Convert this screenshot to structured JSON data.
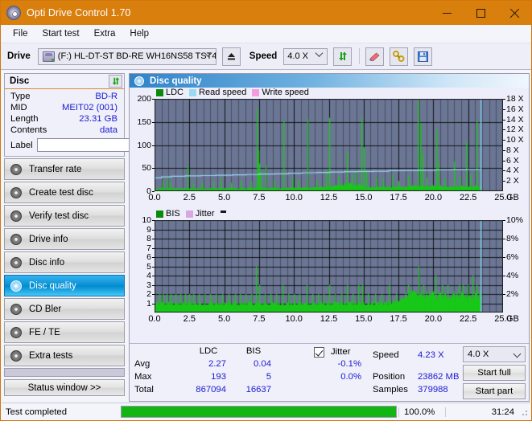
{
  "window": {
    "title": "Opti Drive Control 1.70",
    "app_icon": "disc-icon",
    "minimize": "—",
    "maximize": "□",
    "close": "✕"
  },
  "menu": [
    {
      "label": "File"
    },
    {
      "label": "Start test"
    },
    {
      "label": "Extra"
    },
    {
      "label": "Help"
    }
  ],
  "toolbar": {
    "drive_label": "Drive",
    "drive_value": "(F:)  HL-DT-ST BD-RE  WH16NS58 TST4",
    "eject_icon": "eject-icon",
    "speed_label": "Speed",
    "speed_value": "4.0 X",
    "refresh_icon": "refresh-icon",
    "erase_icon": "eraser-icon",
    "tools_icon": "tools-icon",
    "save_icon": "save-icon"
  },
  "disc_panel": {
    "title": "Disc",
    "refresh_icon": "refresh-icon",
    "rows": [
      {
        "key": "Type",
        "value": "BD-R"
      },
      {
        "key": "MID",
        "value": "MEIT02 (001)"
      },
      {
        "key": "Length",
        "value": "23.31 GB"
      },
      {
        "key": "Contents",
        "value": "data"
      }
    ],
    "label_key": "Label",
    "label_value": "",
    "label_placeholder": "",
    "disc_button_icon": "cd-icon"
  },
  "nav": {
    "items": [
      {
        "label": "Transfer rate",
        "icon": "disc-icon",
        "selected": false
      },
      {
        "label": "Create test disc",
        "icon": "disc-icon",
        "selected": false
      },
      {
        "label": "Verify test disc",
        "icon": "disc-icon",
        "selected": false
      },
      {
        "label": "Drive info",
        "icon": "disc-icon",
        "selected": false
      },
      {
        "label": "Disc info",
        "icon": "disc-icon",
        "selected": false
      },
      {
        "label": "Disc quality",
        "icon": "disc-icon",
        "selected": true
      },
      {
        "label": "CD Bler",
        "icon": "disc-icon",
        "selected": false
      },
      {
        "label": "FE / TE",
        "icon": "disc-icon",
        "selected": false
      },
      {
        "label": "Extra tests",
        "icon": "disc-icon",
        "selected": false
      }
    ],
    "status_window": "Status window >>"
  },
  "panel": {
    "header_title": "Disc quality",
    "header_icon": "disc-quality-icon"
  },
  "stats": {
    "col_ldc": "LDC",
    "col_bis": "BIS",
    "row_avg": "Avg",
    "row_max": "Max",
    "row_total": "Total",
    "ldc_avg": "2.27",
    "ldc_max": "193",
    "ldc_total": "867094",
    "bis_avg": "0.04",
    "bis_max": "5",
    "bis_total": "16637",
    "jitter_label": "Jitter",
    "jitter_checked": true,
    "jitter_avg": "-0.1%",
    "jitter_max": "0.0%",
    "speed_label": "Speed",
    "speed_value": "4.23 X",
    "position_label": "Position",
    "position_value": "23862 MB",
    "samples_label": "Samples",
    "samples_value": "379988",
    "speed_select": "4.0 X",
    "start_full": "Start full",
    "start_part": "Start part"
  },
  "statusbar": {
    "text": "Test completed",
    "percent": "100.0%",
    "progress": 100,
    "elapsed": "31:24"
  },
  "colors": {
    "titlebar": "#d97f0d",
    "accent_green": "#18c818",
    "read_speed": "#9ad9f5",
    "write_speed": "#f59ce0",
    "plot_bg": "#6b7694",
    "value_blue": "#1a1ad0",
    "selection": "#0a8fd4"
  },
  "chart_data": [
    {
      "type": "area",
      "name": "ldc-chart",
      "title": "",
      "xlabel": "GB",
      "ylabel": "LDC",
      "xlim": [
        0,
        25
      ],
      "ylim": [
        0,
        200
      ],
      "y2lim": [
        0,
        18
      ],
      "y2label": "X",
      "grid": true,
      "legend_position": "top-left",
      "legend": [
        {
          "name": "LDC",
          "color": "#0a8a0a"
        },
        {
          "name": "Read speed",
          "color": "#9ad9f5"
        },
        {
          "name": "Write speed",
          "color": "#f59ce0"
        }
      ],
      "yticks": [
        0,
        50,
        100,
        150,
        200
      ],
      "ytick_labels": [
        "0",
        "50",
        "100",
        "150",
        "200"
      ],
      "y2ticks": [
        2,
        4,
        6,
        8,
        10,
        12,
        14,
        16,
        18
      ],
      "y2tick_labels": [
        "2 X",
        "4 X",
        "6 X",
        "8 X",
        "10 X",
        "12 X",
        "14 X",
        "16 X",
        "18 X"
      ],
      "xticks": [
        0,
        2.5,
        5,
        7.5,
        10,
        12.5,
        15,
        17.5,
        20,
        22.5,
        25
      ],
      "xtick_labels": [
        "0.0",
        "2.5",
        "5.0",
        "7.5",
        "10.0",
        "12.5",
        "15.0",
        "17.5",
        "20.0",
        "22.5",
        "25.0"
      ],
      "data_end_gb": 23.4,
      "series": [
        {
          "name": "LDC",
          "color": "#18c818",
          "baseline_x": [
            0.0,
            1.0,
            2.0,
            3.0,
            4.0,
            5.0,
            6.0,
            7.0,
            8.0,
            9.0,
            10.0,
            11.0,
            12.0,
            13.0,
            13.8,
            14.5,
            15.2,
            16.0,
            17.0,
            18.0,
            19.0,
            20.0,
            21.0,
            22.0,
            23.0,
            23.4
          ],
          "baseline_y": [
            5,
            6,
            6,
            6,
            6,
            6,
            6,
            7,
            7,
            7,
            7,
            8,
            9,
            11,
            16,
            14,
            10,
            9,
            9,
            10,
            11,
            11,
            11,
            11,
            11,
            10
          ],
          "spikes": [
            {
              "x": 0.55,
              "y": 22
            },
            {
              "x": 0.9,
              "y": 33
            },
            {
              "x": 1.15,
              "y": 18
            },
            {
              "x": 2.35,
              "y": 55
            },
            {
              "x": 2.75,
              "y": 17
            },
            {
              "x": 3.4,
              "y": 19
            },
            {
              "x": 4.2,
              "y": 22
            },
            {
              "x": 4.75,
              "y": 29
            },
            {
              "x": 5.5,
              "y": 18
            },
            {
              "x": 6.2,
              "y": 24
            },
            {
              "x": 6.95,
              "y": 20
            },
            {
              "x": 7.32,
              "y": 179
            },
            {
              "x": 7.42,
              "y": 88
            },
            {
              "x": 7.5,
              "y": 60
            },
            {
              "x": 7.62,
              "y": 42
            },
            {
              "x": 7.95,
              "y": 57
            },
            {
              "x": 8.55,
              "y": 26
            },
            {
              "x": 9.25,
              "y": 153
            },
            {
              "x": 9.85,
              "y": 30
            },
            {
              "x": 10.3,
              "y": 24
            },
            {
              "x": 10.95,
              "y": 156
            },
            {
              "x": 11.6,
              "y": 25
            },
            {
              "x": 12.3,
              "y": 45
            },
            {
              "x": 12.55,
              "y": 159
            },
            {
              "x": 13.15,
              "y": 33
            },
            {
              "x": 13.8,
              "y": 86
            },
            {
              "x": 14.15,
              "y": 36
            },
            {
              "x": 14.45,
              "y": 46
            },
            {
              "x": 14.82,
              "y": 159
            },
            {
              "x": 15.0,
              "y": 95
            },
            {
              "x": 15.2,
              "y": 44
            },
            {
              "x": 15.9,
              "y": 31
            },
            {
              "x": 16.4,
              "y": 28
            },
            {
              "x": 17.05,
              "y": 38
            },
            {
              "x": 17.5,
              "y": 22
            },
            {
              "x": 18.2,
              "y": 34
            },
            {
              "x": 18.9,
              "y": 196
            },
            {
              "x": 19.05,
              "y": 148
            },
            {
              "x": 19.2,
              "y": 82
            },
            {
              "x": 19.5,
              "y": 29
            },
            {
              "x": 20.2,
              "y": 134
            },
            {
              "x": 20.35,
              "y": 62
            },
            {
              "x": 20.8,
              "y": 27
            },
            {
              "x": 21.5,
              "y": 64
            },
            {
              "x": 21.9,
              "y": 33
            },
            {
              "x": 22.35,
              "y": 107
            },
            {
              "x": 22.65,
              "y": 38
            },
            {
              "x": 23.1,
              "y": 153
            }
          ]
        },
        {
          "name": "Read speed",
          "color": "#9ad9f5",
          "axis": "right",
          "x": [
            0.0,
            0.5,
            1.2,
            2.2,
            3.3,
            4.4,
            5.6,
            6.6,
            7.5,
            8.6,
            9.6,
            10.6,
            11.6,
            12.6,
            13.6,
            14.6,
            15.7,
            16.8,
            17.9,
            19.0,
            20.2,
            21.3,
            22.4,
            23.4
          ],
          "y": [
            2.6,
            2.8,
            2.9,
            3.0,
            3.05,
            3.1,
            3.2,
            3.25,
            3.35,
            3.4,
            3.5,
            3.6,
            3.65,
            3.75,
            3.8,
            3.85,
            3.9,
            4.0,
            4.05,
            4.1,
            4.15,
            4.2,
            4.23,
            4.23
          ]
        },
        {
          "name": "vertical-marker",
          "color": "#7fd4f2",
          "type": "vline",
          "x": 23.4
        }
      ]
    },
    {
      "type": "area",
      "name": "bis-chart",
      "title": "",
      "xlabel": "GB",
      "ylabel": "BIS",
      "xlim": [
        0,
        25
      ],
      "ylim": [
        0,
        10
      ],
      "y2lim": [
        0,
        10
      ],
      "y2label": "%",
      "grid": true,
      "legend_position": "top-left",
      "legend": [
        {
          "name": "BIS",
          "color": "#0a8a0a"
        },
        {
          "name": "Jitter",
          "color": "#d9a8e0"
        }
      ],
      "yticks": [
        1,
        2,
        3,
        4,
        5,
        6,
        7,
        8,
        9,
        10
      ],
      "ytick_labels": [
        "1",
        "2",
        "3",
        "4",
        "5",
        "6",
        "7",
        "8",
        "9",
        "10"
      ],
      "y2ticks": [
        2,
        4,
        6,
        8,
        10
      ],
      "y2tick_labels": [
        "2%",
        "4%",
        "6%",
        "8%",
        "10%"
      ],
      "xticks": [
        0,
        2.5,
        5,
        7.5,
        10,
        12.5,
        15,
        17.5,
        20,
        22.5,
        25
      ],
      "xtick_labels": [
        "0.0",
        "2.5",
        "5.0",
        "7.5",
        "10.0",
        "12.5",
        "15.0",
        "17.5",
        "20.0",
        "22.5",
        "25.0"
      ],
      "data_end_gb": 23.4,
      "series": [
        {
          "name": "BIS",
          "color": "#18c818",
          "baseline_x": [
            0.0,
            5.0,
            10.0,
            14.0,
            16.0,
            17.6,
            17.9,
            20.0,
            22.0,
            23.4
          ],
          "baseline_y": [
            1.0,
            1.0,
            1.0,
            1.0,
            1.1,
            1.2,
            2.0,
            2.0,
            2.0,
            2.0
          ],
          "spikes": [
            {
              "x": 0.35,
              "y": 2
            },
            {
              "x": 0.6,
              "y": 2
            },
            {
              "x": 0.85,
              "y": 2
            },
            {
              "x": 1.15,
              "y": 2
            },
            {
              "x": 1.5,
              "y": 2
            },
            {
              "x": 1.85,
              "y": 2
            },
            {
              "x": 2.2,
              "y": 2
            },
            {
              "x": 2.5,
              "y": 2
            },
            {
              "x": 2.8,
              "y": 2
            },
            {
              "x": 3.2,
              "y": 2
            },
            {
              "x": 3.6,
              "y": 2
            },
            {
              "x": 4.0,
              "y": 2
            },
            {
              "x": 4.4,
              "y": 2
            },
            {
              "x": 4.85,
              "y": 2
            },
            {
              "x": 5.3,
              "y": 2
            },
            {
              "x": 5.75,
              "y": 2
            },
            {
              "x": 6.1,
              "y": 2
            },
            {
              "x": 6.5,
              "y": 2
            },
            {
              "x": 6.9,
              "y": 2
            },
            {
              "x": 7.3,
              "y": 5
            },
            {
              "x": 7.5,
              "y": 3
            },
            {
              "x": 7.9,
              "y": 2
            },
            {
              "x": 8.3,
              "y": 2
            },
            {
              "x": 8.7,
              "y": 2
            },
            {
              "x": 9.2,
              "y": 3
            },
            {
              "x": 9.6,
              "y": 2
            },
            {
              "x": 10.0,
              "y": 2
            },
            {
              "x": 10.4,
              "y": 2
            },
            {
              "x": 10.9,
              "y": 3
            },
            {
              "x": 11.3,
              "y": 2
            },
            {
              "x": 11.7,
              "y": 2
            },
            {
              "x": 12.1,
              "y": 2
            },
            {
              "x": 12.55,
              "y": 3
            },
            {
              "x": 12.95,
              "y": 2
            },
            {
              "x": 13.4,
              "y": 2
            },
            {
              "x": 13.8,
              "y": 3
            },
            {
              "x": 14.2,
              "y": 2
            },
            {
              "x": 14.6,
              "y": 3
            },
            {
              "x": 14.9,
              "y": 3
            },
            {
              "x": 15.3,
              "y": 2
            },
            {
              "x": 15.8,
              "y": 2
            },
            {
              "x": 16.3,
              "y": 2
            },
            {
              "x": 16.8,
              "y": 3
            },
            {
              "x": 17.3,
              "y": 2
            },
            {
              "x": 18.2,
              "y": 3
            },
            {
              "x": 18.6,
              "y": 2
            },
            {
              "x": 18.95,
              "y": 5
            },
            {
              "x": 19.3,
              "y": 3
            },
            {
              "x": 19.7,
              "y": 2
            },
            {
              "x": 20.15,
              "y": 4
            },
            {
              "x": 20.6,
              "y": 3
            },
            {
              "x": 21.0,
              "y": 3
            },
            {
              "x": 21.4,
              "y": 2
            },
            {
              "x": 21.8,
              "y": 3
            },
            {
              "x": 22.1,
              "y": 3
            },
            {
              "x": 22.45,
              "y": 3
            },
            {
              "x": 22.8,
              "y": 4
            },
            {
              "x": 23.1,
              "y": 3
            }
          ]
        },
        {
          "name": "vertical-marker",
          "color": "#7fd4f2",
          "type": "vline",
          "x": 23.4
        }
      ]
    }
  ]
}
